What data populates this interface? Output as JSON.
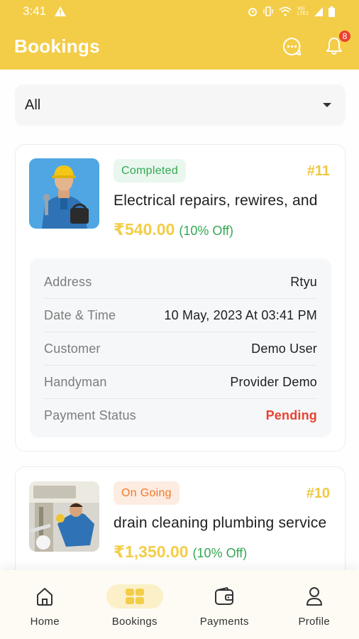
{
  "status_bar": {
    "time": "3:41",
    "network": "Vo) LTE1"
  },
  "app_bar": {
    "title": "Bookings",
    "notification_count": "8"
  },
  "filter": {
    "selected": "All"
  },
  "colors": {
    "accent": "#f3cd48",
    "success": "#34a853",
    "warning": "#f2782c",
    "danger": "#e8422f"
  },
  "bookings": [
    {
      "status": "Completed",
      "id": "#11",
      "service": "Electrical repairs, rewires, and",
      "price": "₹540.00",
      "discount": "(10% Off)",
      "details": [
        {
          "label": "Address",
          "value": "Rtyu"
        },
        {
          "label": "Date & Time",
          "value": "10 May, 2023 At 03:41 PM"
        },
        {
          "label": "Customer",
          "value": "Demo User"
        },
        {
          "label": "Handyman",
          "value": "Provider Demo"
        },
        {
          "label": "Payment Status",
          "value": "Pending"
        }
      ]
    },
    {
      "status": "On Going",
      "id": "#10",
      "service": "drain cleaning plumbing service",
      "price": "₹1,350.00",
      "discount": "(10% Off)"
    }
  ],
  "nav": [
    {
      "label": "Home",
      "icon": "home-icon"
    },
    {
      "label": "Bookings",
      "icon": "bookings-icon",
      "active": true
    },
    {
      "label": "Payments",
      "icon": "wallet-icon"
    },
    {
      "label": "Profile",
      "icon": "profile-icon"
    }
  ]
}
